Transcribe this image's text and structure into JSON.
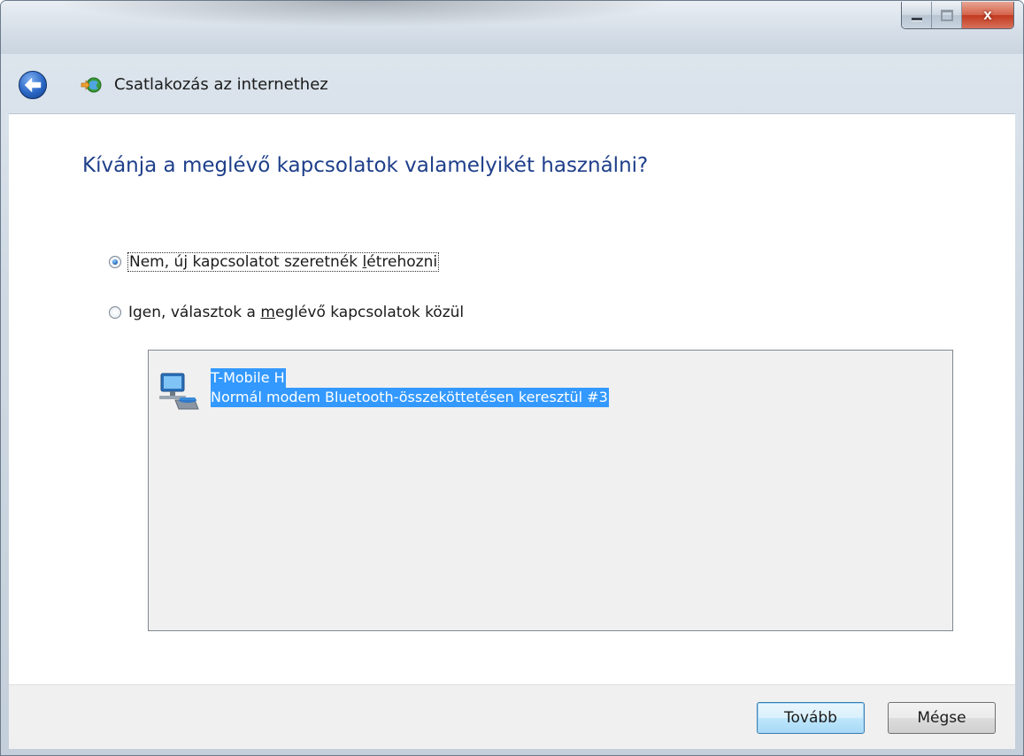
{
  "window": {
    "title": "Csatlakozás az internethez",
    "close_glyph": "x"
  },
  "main": {
    "heading": "Kívánja a meglévő kapcsolatok valamelyikét használni?",
    "options": [
      {
        "prefix": "Nem, új kapcsolatot szeretnék ",
        "accel": "l",
        "suffix": "étrehozni",
        "checked": true
      },
      {
        "prefix": "Igen, választok a ",
        "accel": "m",
        "suffix": "eglévő kapcsolatok közül",
        "checked": false
      }
    ],
    "connections": [
      {
        "name": "T-Mobile H",
        "description": "Normál modem Bluetooth-összeköttetésen keresztül #3",
        "icon": "dialup-connection-icon",
        "selected": true
      }
    ]
  },
  "footer": {
    "next_label": "Tovább",
    "cancel_label": "Mégse"
  }
}
